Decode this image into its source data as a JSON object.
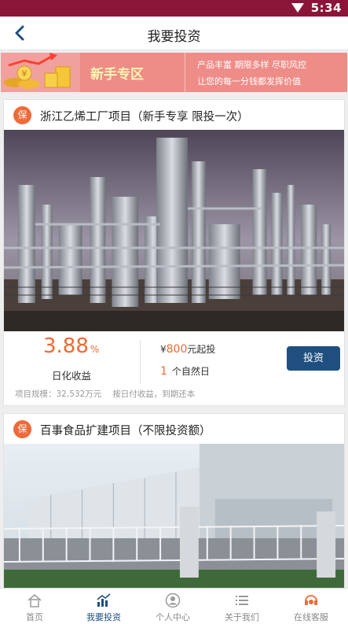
{
  "status_bar": {
    "time": "5:34",
    "wifi_icon": "wifi-icon"
  },
  "nav": {
    "back_icon": "chevron-left-icon",
    "title": "我要投资"
  },
  "banner": {
    "title": "新手专区",
    "line1": "产品丰富 期限多样 尽职风控",
    "line2": "让您的每一分钱都发挥价值",
    "colors": {
      "background": "#ee8c87",
      "title": "#fff6b0"
    }
  },
  "projects": [
    {
      "badge": "保",
      "title": "浙江乙烯工厂项目（新手专享 限投一次）",
      "rate": "3.88",
      "rate_unit": "%",
      "rate_label": "日化收益",
      "min_prefix": "¥",
      "min_amount": "800",
      "min_suffix": "元起投",
      "period_value": "1",
      "period_unit": "个自然日",
      "invest_label": "投资",
      "scale_text": "项目规模：32,532万元",
      "repay_text": "按日付收益，到期还本"
    },
    {
      "badge": "保",
      "title": "百事食品扩建项目（不限投资额）"
    }
  ],
  "tabs": [
    {
      "label": "首页",
      "icon": "home-icon",
      "active": false
    },
    {
      "label": "我要投资",
      "icon": "chart-icon",
      "active": true
    },
    {
      "label": "个人中心",
      "icon": "user-icon",
      "active": false
    },
    {
      "label": "关于我们",
      "icon": "list-icon",
      "active": false
    },
    {
      "label": "在线客服",
      "icon": "headset-icon",
      "active": false
    }
  ],
  "colors": {
    "status_bar": "#8b1538",
    "accent_orange": "#f06a33",
    "primary_blue": "#1f4f7f"
  }
}
